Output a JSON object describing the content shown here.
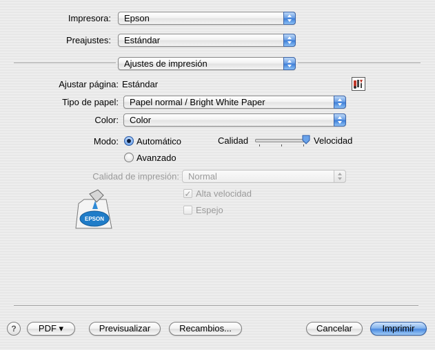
{
  "printer": {
    "label": "Impresora:",
    "value": "Epson"
  },
  "presets": {
    "label": "Preajustes:",
    "value": "Estándar"
  },
  "panel_menu": {
    "value": "Ajustes de impresión"
  },
  "page_setup": {
    "label": "Ajustar página:",
    "value": "Estándar",
    "icon": "printer-tools-icon"
  },
  "paper_type": {
    "label": "Tipo de papel:",
    "value": "Papel normal / Bright White Paper"
  },
  "color": {
    "label": "Color:",
    "value": "Color"
  },
  "mode": {
    "label": "Modo:",
    "options": [
      {
        "label": "Automático",
        "selected": true
      },
      {
        "label": "Avanzado",
        "selected": false
      }
    ],
    "slider": {
      "left_label": "Calidad",
      "right_label": "Velocidad",
      "level": 1.0
    }
  },
  "print_quality": {
    "label": "Calidad de impresión:",
    "value": "Normal",
    "enabled": false
  },
  "checkboxes": [
    {
      "label": "Alta velocidad",
      "checked": true,
      "enabled": false
    },
    {
      "label": "Espejo",
      "checked": false,
      "enabled": false
    }
  ],
  "epson_logo": {
    "text": "EPSON"
  },
  "footer": {
    "help": "?",
    "pdf": "PDF ▾",
    "preview": "Previsualizar",
    "supplies": "Recambios...",
    "cancel": "Cancelar",
    "print": "Imprimir"
  },
  "colors": {
    "accent": "#4c8ae0",
    "disabled_text": "#9a9a9a"
  }
}
